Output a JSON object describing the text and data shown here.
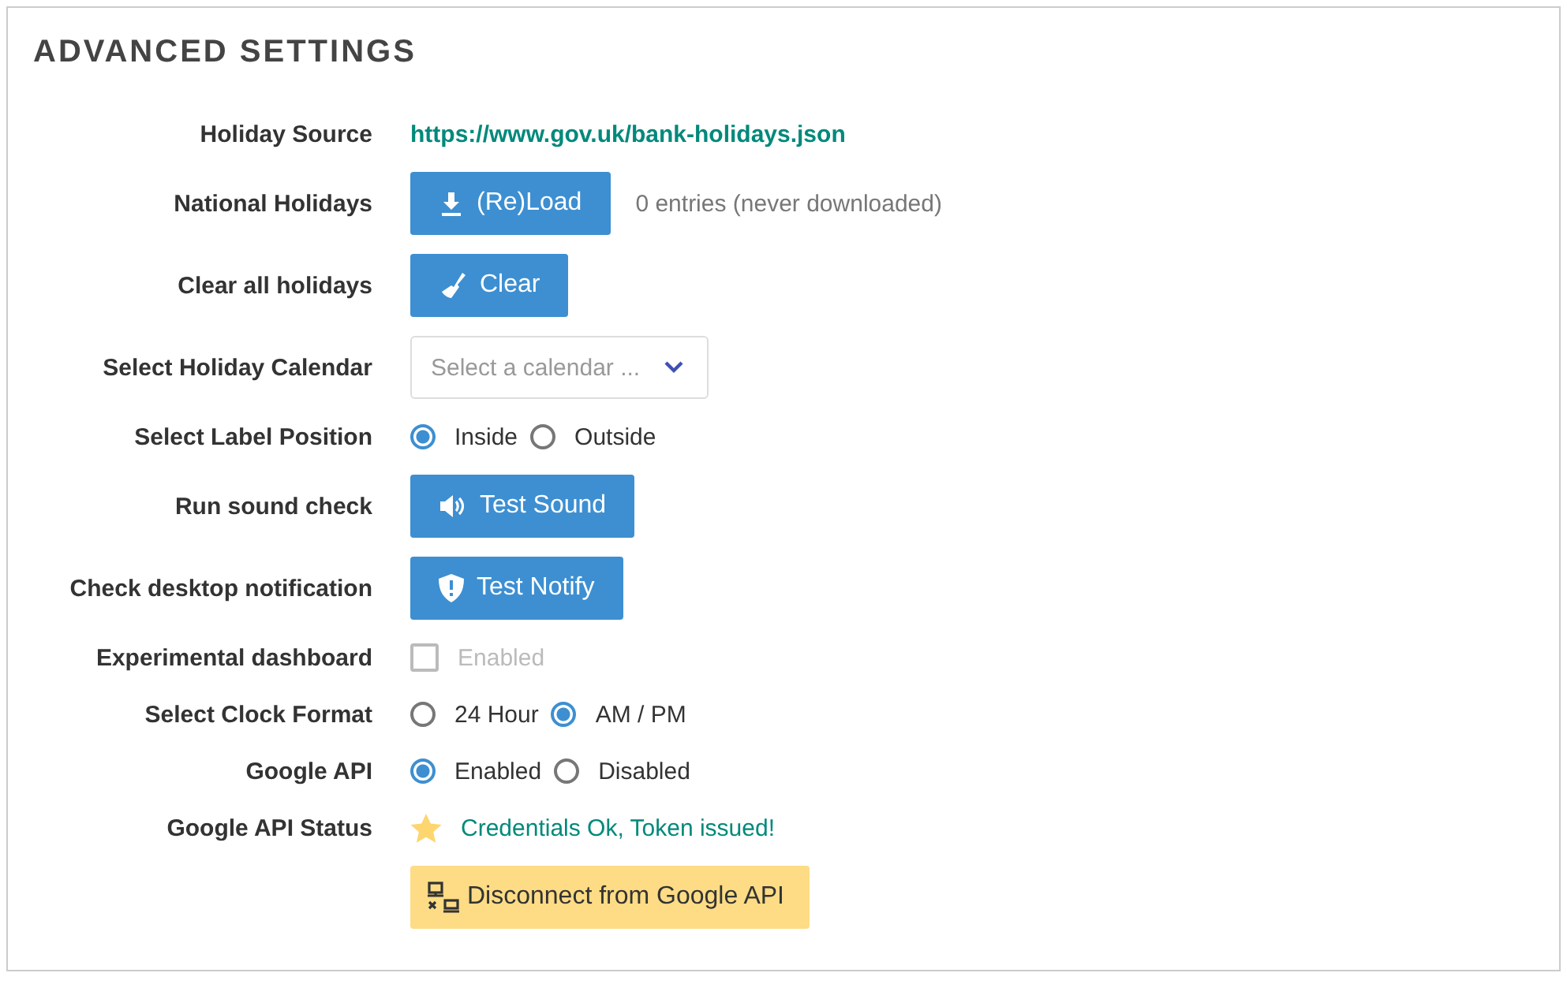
{
  "title": "ADVANCED SETTINGS",
  "rows": [
    {
      "kind": "link",
      "label": "Holiday Source",
      "text": "https://www.gov.uk/bank-holidays.json"
    },
    {
      "kind": "button",
      "label": "National Holidays",
      "button": "(Re)Load",
      "color": "#3d8fd1",
      "note": "0 entries (never downloaded)"
    },
    {
      "kind": "button",
      "label": "Clear all holidays",
      "button": "Clear",
      "color": "#3d8fd1"
    },
    {
      "kind": "select",
      "label": "Select Holiday Calendar",
      "placeholder": "Select a calendar ..."
    },
    {
      "kind": "radio",
      "label": "Select Label Position",
      "options": [
        {
          "label": "Inside",
          "selected": true
        },
        {
          "label": "Outside",
          "selected": false
        }
      ]
    },
    {
      "kind": "button",
      "label": "Run sound check",
      "button": "Test Sound",
      "color": "#3d8fd1"
    },
    {
      "kind": "button",
      "label": "Check desktop notification",
      "button": "Test Notify",
      "color": "#3d8fd1"
    },
    {
      "kind": "checkbox",
      "label": "Experimental dashboard",
      "text": "Enabled",
      "checked": false,
      "disabled": true
    },
    {
      "kind": "radio",
      "label": "Select Clock Format",
      "options": [
        {
          "label": "24 Hour",
          "selected": false
        },
        {
          "label": "AM / PM",
          "selected": true
        }
      ]
    },
    {
      "kind": "radio",
      "label": "Google API",
      "options": [
        {
          "label": "Enabled",
          "selected": true
        },
        {
          "label": "Disabled",
          "selected": false
        }
      ]
    },
    {
      "kind": "status",
      "label": "Google API Status",
      "text": "Credentials Ok, Token issued!"
    },
    {
      "kind": "button",
      "button": "Disconnect from Google API",
      "color": "#fddc85"
    }
  ]
}
